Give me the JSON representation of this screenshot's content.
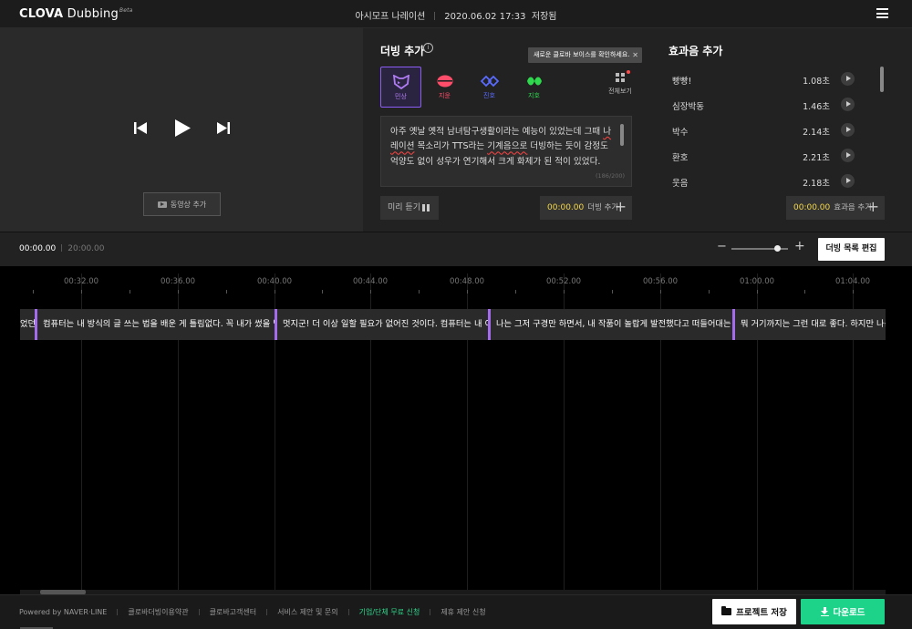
{
  "header": {
    "logo_bold": "CLOVA",
    "logo_light": " Dubbing",
    "logo_beta": "Beta",
    "project_name": "아시모프 나레이션",
    "saved_time": "2020.06.02 17:33",
    "saved_label": "저장됨"
  },
  "dubbing": {
    "title": "더빙 추가",
    "info_glyph": "i",
    "tooltip": "새로운 클로바 보이스를 확인하세요.",
    "tooltip_close": "✕",
    "voices": [
      {
        "label": "민상",
        "color": "#b07cf5",
        "selected": true
      },
      {
        "label": "지윤",
        "color": "#ff4d6a",
        "selected": false
      },
      {
        "label": "진호",
        "color": "#5a6cff",
        "selected": false
      },
      {
        "label": "지호",
        "color": "#2fd94e",
        "selected": false
      }
    ],
    "all_voices_label": "전체보기",
    "script_parts": [
      "아주 옛날 옛적 남녀탐구생활이라는 예능이 있었는데 그때 ",
      "나레이션",
      " 목소리가 TTS라는 ",
      "기계음으로",
      " 더빙하는 듯이 감정도 억양도 없이 성우가 연기해서 크게 화제가 된 적이 있었다."
    ],
    "char_count": "(186/200)",
    "preview_label": "미리 듣기",
    "add_time": "00:00.00",
    "add_label": "더빙 추가",
    "plus": "+"
  },
  "effects": {
    "title": "효과음 추가",
    "items": [
      {
        "name": "빵빵!",
        "duration": "1.08초"
      },
      {
        "name": "심장박동",
        "duration": "1.46초"
      },
      {
        "name": "박수",
        "duration": "2.14초"
      },
      {
        "name": "환호",
        "duration": "2.21초"
      },
      {
        "name": "웃음",
        "duration": "2.18초"
      }
    ],
    "add_time": "00:00.00",
    "add_label": "효과음 추가",
    "plus": "+"
  },
  "video": {
    "add_video_label": "동영상 추가"
  },
  "timeline": {
    "current_time": "00:00.00",
    "total_time": "20:00.00",
    "zoom_minus": "−",
    "zoom_plus": "+",
    "zoom_level": 0.85,
    "edit_list_label": "더빙 목록 편집",
    "ticks": [
      "00:32.00",
      "00:36.00",
      "00:40.00",
      "00:44.00",
      "00:48.00",
      "00:52.00",
      "00:56.00",
      "01:00.00",
      "01:04.00"
    ],
    "clips": [
      "었던 ",
      "컴퓨터는 내 방식의 글 쓰는 법을 배운 게 틀림없다. 꼭 내가 썼을 법한 글을",
      "멋지군! 더 이상 일할 필요가 없어진 것이다. 컴퓨터는 내 이름으로",
      "나는 그저 구경만 하면서, 내 작품이 놀랍게 발전했다고 떠들어대는 비평가들",
      "뭐 거기까지는 그런 대로 좋다. 하지만 나는 권위"
    ]
  },
  "footer": {
    "links": [
      "Powered by NAVER·LINE",
      "클로바더빙이용약관",
      "클로바고객센터",
      "서비스 제안 및 문의",
      "기업/단체 무료 신청",
      "제휴 제안 신청"
    ],
    "save_label": "프로젝트 저장",
    "download_label": "다운로드"
  }
}
